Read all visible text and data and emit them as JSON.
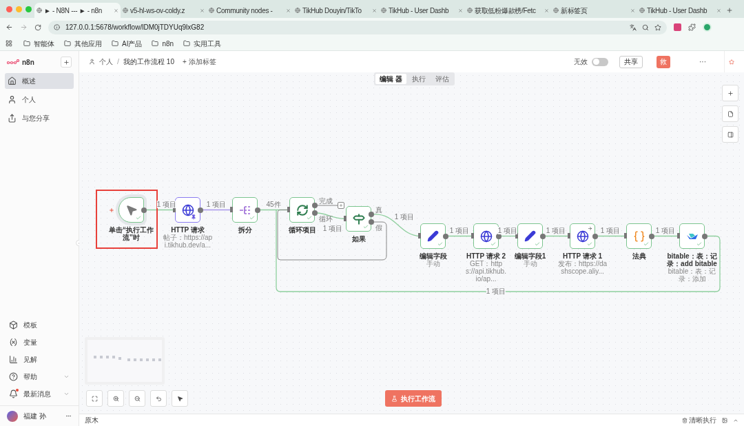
{
  "browser": {
    "tabs": [
      {
        "title": "► - N8N --- ► - n8n",
        "selected": true
      },
      {
        "title": "v5-hl-ws-ov-coldy.z",
        "selected": false
      },
      {
        "title": "Community nodes -",
        "selected": false
      },
      {
        "title": "TikHub Douyin/TikTo",
        "selected": false
      },
      {
        "title": "TikHub - User Dashb",
        "selected": false
      },
      {
        "title": "获取低粉爆款榜/Fetc",
        "selected": false
      },
      {
        "title": "新标签页",
        "selected": false
      },
      {
        "title": "TikHub - User Dashb",
        "selected": false
      }
    ],
    "address": "127.0.0.1:5678/workflow/lDM0jTDYUq9lxG82",
    "bookmarks": [
      "智能体",
      "其他应用",
      "AI产品",
      "n8n",
      "实用工具"
    ]
  },
  "sidebar": {
    "logo": "n8n",
    "items": [
      {
        "label": "概述",
        "kind": "home",
        "selected": true
      },
      {
        "label": "个人",
        "kind": "user",
        "selected": false
      },
      {
        "label": "与您分享",
        "kind": "share",
        "selected": false
      }
    ],
    "bottom_items": [
      {
        "label": "模板",
        "kind": "templates",
        "expandable": false,
        "notification": false
      },
      {
        "label": "变量",
        "kind": "variables",
        "expandable": false,
        "notification": false
      },
      {
        "label": "见解",
        "kind": "insights",
        "expandable": false,
        "notification": false
      },
      {
        "label": "帮助",
        "kind": "help",
        "expandable": true,
        "notification": false
      },
      {
        "label": "最新消息",
        "kind": "news",
        "expandable": true,
        "notification": true
      }
    ],
    "user": {
      "name": "福建 孙"
    }
  },
  "header": {
    "owner": "个人",
    "separator": "/",
    "workflow": "我的工作流程 10",
    "add_tag": "+ 添加标签",
    "active_label": "无效",
    "active": false,
    "share": "共享",
    "save": "救",
    "more": "···"
  },
  "view_tabs": [
    {
      "label": "编辑 器",
      "selected": true
    },
    {
      "label": "执行",
      "selected": false
    },
    {
      "label": "评估",
      "selected": false
    }
  ],
  "nodes": [
    {
      "kind": "trigger",
      "title": "单击“执行工作流”时",
      "pinned": false,
      "highlighted": true,
      "arrow": false
    },
    {
      "kind": "http",
      "title": "HTTP 请求",
      "subtitle": "帖子：https://api.tikhub.dev/a...",
      "pinned": true,
      "highlighted": false,
      "arrow": false
    },
    {
      "kind": "split",
      "title": "拆分",
      "pinned": false,
      "highlighted": false,
      "arrow": false
    },
    {
      "kind": "loop",
      "title": "循环项目",
      "pinned": false,
      "highlighted": false,
      "arrow": false,
      "outputs": [
        "完成",
        "循环"
      ]
    },
    {
      "kind": "if",
      "title": "如果",
      "pinned": false,
      "highlighted": false,
      "arrow": false,
      "outputs": [
        "真",
        "假"
      ]
    },
    {
      "kind": "set",
      "title": "编辑字段",
      "subtitle": "手动",
      "pinned": false,
      "highlighted": false,
      "arrow": false
    },
    {
      "kind": "http",
      "title": "HTTP 请求 2",
      "subtitle": "GET：https://api.tikhub.io/ap...",
      "pinned": false,
      "highlighted": false,
      "arrow": false
    },
    {
      "kind": "set",
      "title": "编辑字段1",
      "subtitle": "手动",
      "pinned": false,
      "highlighted": false,
      "arrow": false
    },
    {
      "kind": "http",
      "title": "HTTP 请求 1",
      "subtitle": "发布：https://dashscope.aliy...",
      "pinned": false,
      "highlighted": false,
      "arrow": true
    },
    {
      "kind": "code",
      "title": "法典",
      "pinned": false,
      "highlighted": false,
      "arrow": false
    },
    {
      "kind": "bitable",
      "title": "bitable：表：记录：add bitable",
      "subtitle": "bitable：表：记录：添加",
      "pinned": false,
      "highlighted": false,
      "arrow": false
    }
  ],
  "edge_labels": [
    "1 项目",
    "1 项目",
    "45件",
    "1 项目",
    "1 项目",
    "1 项目",
    "1 项目",
    "1 项目",
    "1 项目",
    "1 项目",
    "1 项目"
  ],
  "execute_button": "执行工作流",
  "bottom_bar": {
    "logs": "原木",
    "clear": "清晰执行"
  }
}
